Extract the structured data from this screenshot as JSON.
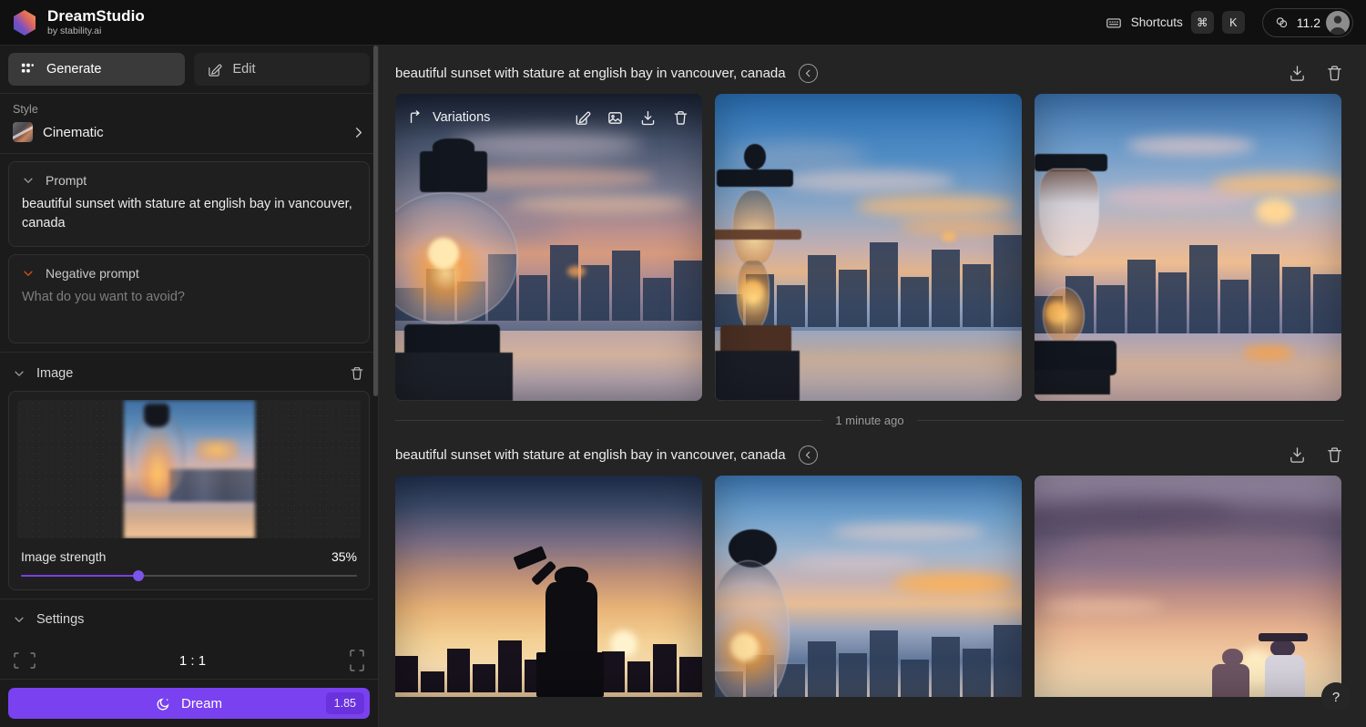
{
  "app": {
    "brand_name": "DreamStudio",
    "brand_sub": "by stability.ai"
  },
  "topbar": {
    "shortcuts_icon": "keyboard-icon",
    "shortcuts_label": "Shortcuts",
    "kbd_cmd": "⌘",
    "kbd_key": "K",
    "credits_icon": "coins-icon",
    "credits_value": "11.2",
    "avatar_icon": "user-avatar-icon"
  },
  "sidebar": {
    "tabs": [
      {
        "label": "Generate",
        "icon": "grid-icon",
        "active": true
      },
      {
        "label": "Edit",
        "icon": "pencil-square-icon",
        "active": false
      }
    ],
    "style": {
      "label": "Style",
      "value": "Cinematic",
      "chevron": "chevron-right-icon"
    },
    "prompt": {
      "header": "Prompt",
      "value": "beautiful sunset with stature at english bay in vancouver, canada",
      "chevron": "chevron-down-icon"
    },
    "negative_prompt": {
      "header": "Negative prompt",
      "placeholder": "What do you want to avoid?",
      "chevron": "chevron-down-icon",
      "chevron_color": "#d4541f"
    },
    "image_section": {
      "header": "Image",
      "delete_icon": "trash-icon",
      "chevron": "chevron-down-icon",
      "strength_label": "Image strength",
      "strength_value": "35%",
      "strength_percent": 35
    },
    "settings_section": {
      "header": "Settings",
      "chevron": "chevron-down-icon",
      "aspect_ratio": "1 : 1",
      "ratio_percent": 48,
      "landscape_icon": "landscape-ratio-icon",
      "portrait_icon": "portrait-ratio-icon"
    },
    "dream_button": {
      "label": "Dream",
      "icon": "moon-icon",
      "cost": "1.85",
      "color": "#7a41f0"
    }
  },
  "main": {
    "help_button": "?",
    "results": [
      {
        "title": "beautiful sunset with stature at english bay in vancouver, canada",
        "back_icon": "circle-arrow-left-icon",
        "download_icon": "download-icon",
        "delete_icon": "trash-icon",
        "overlay": {
          "variations_label": "Variations",
          "variations_icon": "branch-icon",
          "edit_icon": "pencil-square-icon",
          "image_icon": "picture-icon",
          "download_icon": "download-icon",
          "delete_icon": "trash-icon"
        },
        "images": [
          {
            "alt": "glass lantern bulb with sunset reflection and vancouver skyline"
          },
          {
            "alt": "brass oil lantern glowing against blue sunset city skyline"
          },
          {
            "alt": "tall glass lantern on waterfront with orange sunset clouds"
          }
        ]
      },
      {
        "title": "beautiful sunset with stature at english bay in vancouver, canada",
        "back_icon": "circle-arrow-left-icon",
        "download_icon": "download-icon",
        "delete_icon": "trash-icon",
        "images": [
          {
            "alt": "silhouette of statue raising arm against golden sunset skyline"
          },
          {
            "alt": "glass bulb lantern with sunset inside and blue city skyline"
          },
          {
            "alt": "two figures silhouetted against purple and orange sunset clouds"
          }
        ]
      }
    ],
    "timestamp_divider": "1 minute ago"
  }
}
